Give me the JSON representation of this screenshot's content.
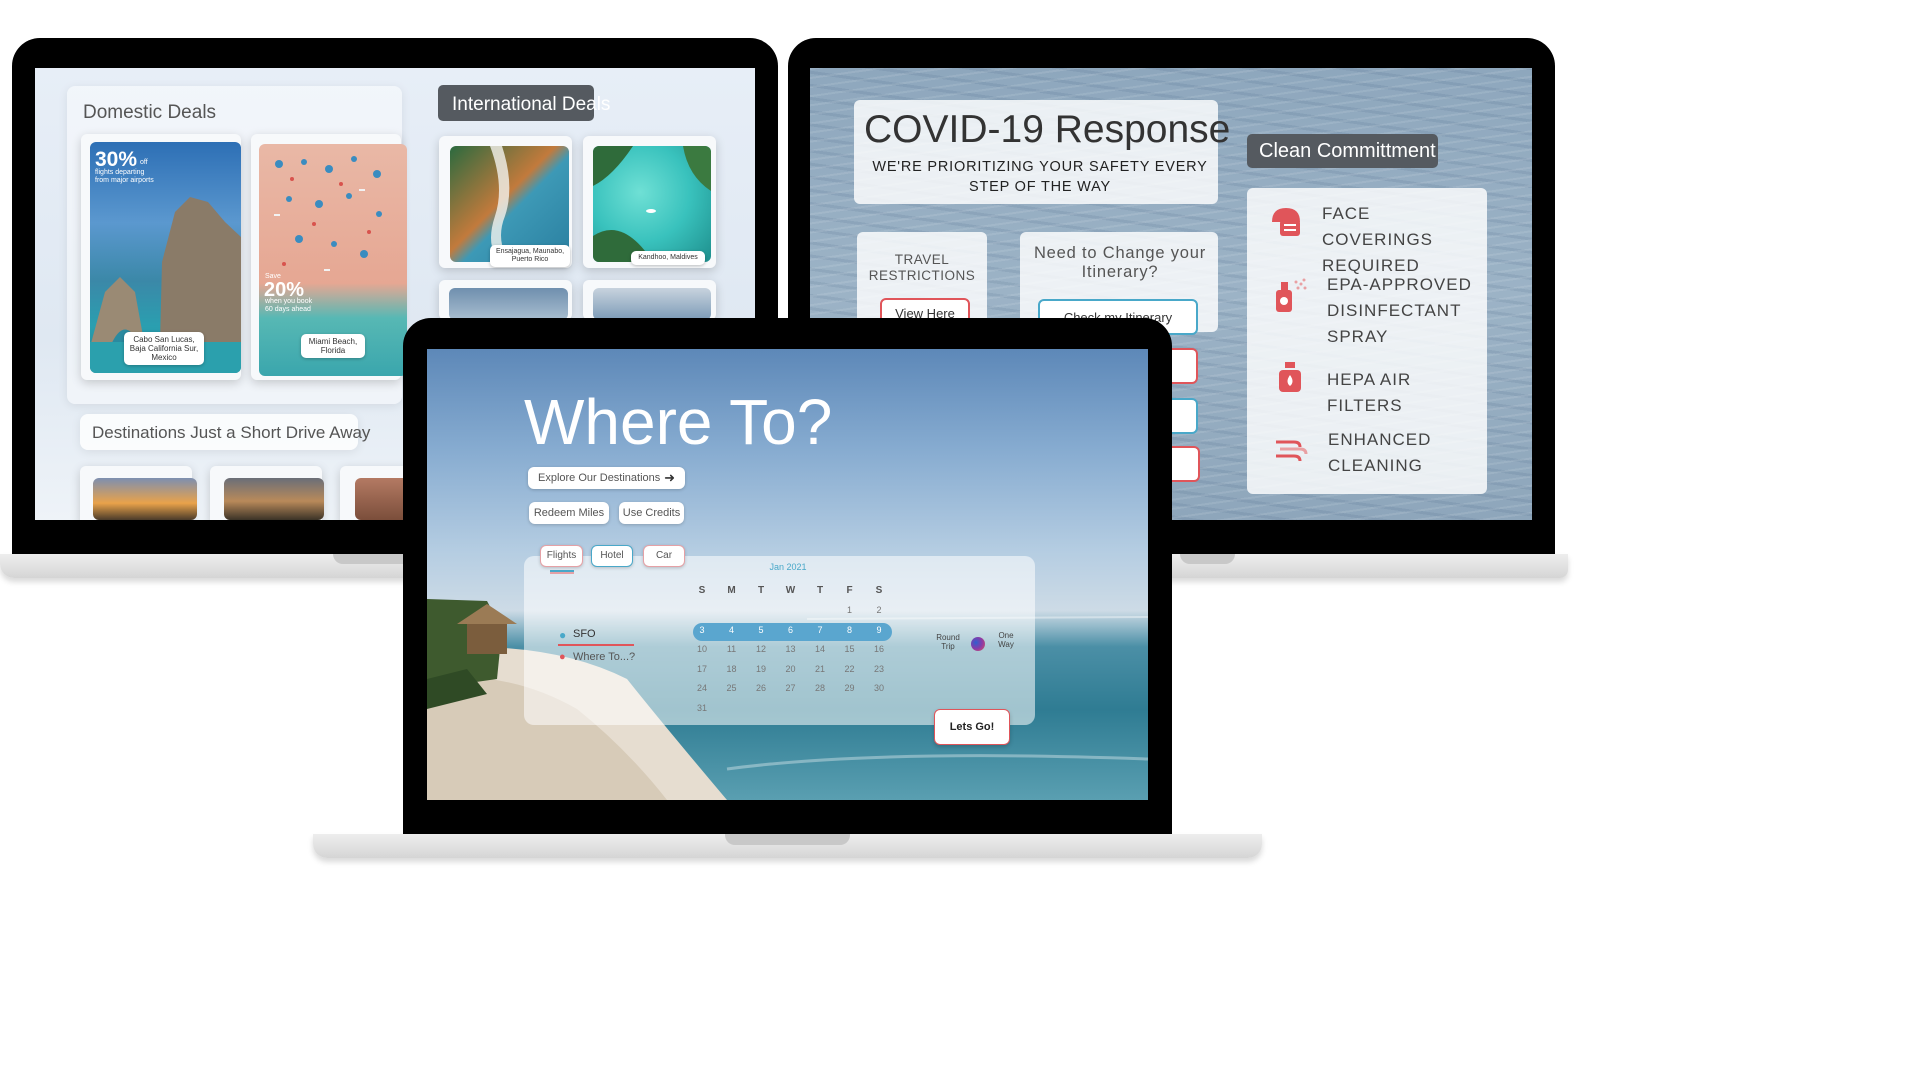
{
  "left": {
    "domestic_title": "Domestic Deals",
    "international_title": "International Deals",
    "drive_title": "Destinations Just a Short Drive Away",
    "deal1": {
      "percent": "30%",
      "percent_suffix": "off",
      "sub": "flights departing from major airports",
      "caption": "Cabo San Lucas, Baja California Sur, Mexico"
    },
    "deal2": {
      "save": "Save",
      "percent": "20%",
      "sub": "when you book 60 days ahead",
      "caption": "Miami Beach, Florida"
    },
    "intl1": {
      "caption": "Ensajagua, Maunabo, Puerto Rico"
    },
    "intl2": {
      "caption": "Kandhoo, Maldives"
    }
  },
  "right": {
    "title": "COVID-19 Response",
    "subtitle": "WE'RE PRIORITIZING YOUR SAFETY EVERY STEP OF THE WAY",
    "travel_restrictions": "TRAVEL RESTRICTIONS",
    "view_here": "View Here",
    "change_title": "Need to Change your Itinerary?",
    "check_itinerary": "Check my Itinerary",
    "clean_title": "Clean Committment",
    "items": [
      {
        "label": "FACE COVERINGS REQUIRED",
        "icon": "mask-icon"
      },
      {
        "label": "EPA-APPROVED DISINFECTANT SPRAY",
        "icon": "spray-icon"
      },
      {
        "label": "HEPA AIR FILTERS",
        "icon": "air-filter-icon"
      },
      {
        "label": "ENHANCED CLEANING",
        "icon": "cleaning-icon"
      }
    ],
    "accent": "#e0555a"
  },
  "center": {
    "headline": "Where To?",
    "explore": "Explore Our Destinations",
    "redeem": "Redeem Miles",
    "credits": "Use Credits",
    "tabs": [
      "Flights",
      "Hotel",
      "Car"
    ],
    "origin": "SFO",
    "destination": "Where To...?",
    "month": "Jan 2021",
    "weekdays": [
      "S",
      "M",
      "T",
      "W",
      "T",
      "F",
      "S"
    ],
    "weeks": [
      [
        "",
        "",
        "",
        "",
        "",
        "1",
        "2"
      ],
      [
        "3",
        "4",
        "5",
        "6",
        "7",
        "8",
        "9"
      ],
      [
        "10",
        "11",
        "12",
        "13",
        "14",
        "15",
        "16"
      ],
      [
        "17",
        "18",
        "19",
        "20",
        "21",
        "22",
        "23"
      ],
      [
        "24",
        "25",
        "26",
        "27",
        "28",
        "29",
        "30"
      ],
      [
        "31",
        "",
        "",
        "",
        "",
        "",
        ""
      ]
    ],
    "selected_week_index": 1,
    "round_trip": "Round Trip",
    "one_way": "One Way",
    "go": "Lets Go!",
    "accent_blue": "#49a8c9"
  }
}
